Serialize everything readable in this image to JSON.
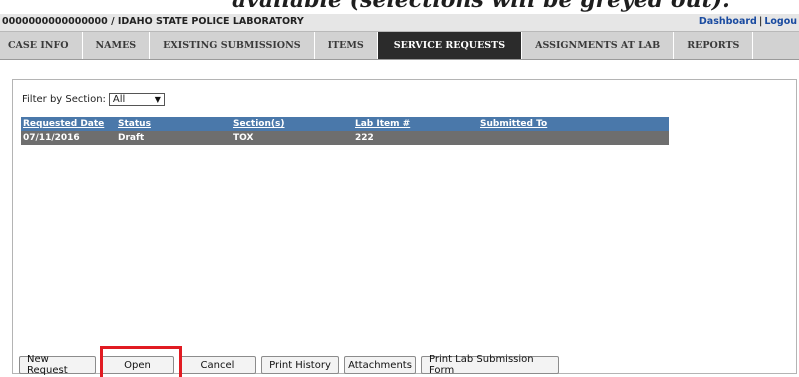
{
  "doc_caption": "available (selections will be greyed out).",
  "header": {
    "case_title": "0000000000000000 / IDAHO STATE POLICE LABORATORY",
    "links": [
      "Dashboard",
      "Logou"
    ],
    "link_separator": "|"
  },
  "tabs": [
    {
      "label": "CASE INFO",
      "active": false
    },
    {
      "label": "NAMES",
      "active": false
    },
    {
      "label": "EXISTING SUBMISSIONS",
      "active": false
    },
    {
      "label": "ITEMS",
      "active": false
    },
    {
      "label": "SERVICE REQUESTS",
      "active": true
    },
    {
      "label": "ASSIGNMENTS AT LAB",
      "active": false
    },
    {
      "label": "REPORTS",
      "active": false
    }
  ],
  "filter": {
    "label": "Filter by Section:",
    "selected": "All"
  },
  "grid": {
    "columns": [
      "Requested Date",
      "Status",
      "Section(s)",
      "Lab Item #",
      "Submitted To"
    ],
    "rows": [
      [
        "07/11/2016",
        "Draft",
        "TOX",
        "222",
        ""
      ]
    ]
  },
  "buttons": {
    "new_request": "New Request",
    "open": "Open",
    "cancel": "Cancel",
    "print_history": "Print History",
    "attachments": "Attachments",
    "print_lab_form": "Print Lab Submission Form"
  },
  "colors": {
    "grid_header": "#4a78aa",
    "grid_row_selected": "#6e6e6e",
    "active_tab": "#2b2b2b",
    "highlight": "#e11b22",
    "link": "#1a4ba0"
  }
}
